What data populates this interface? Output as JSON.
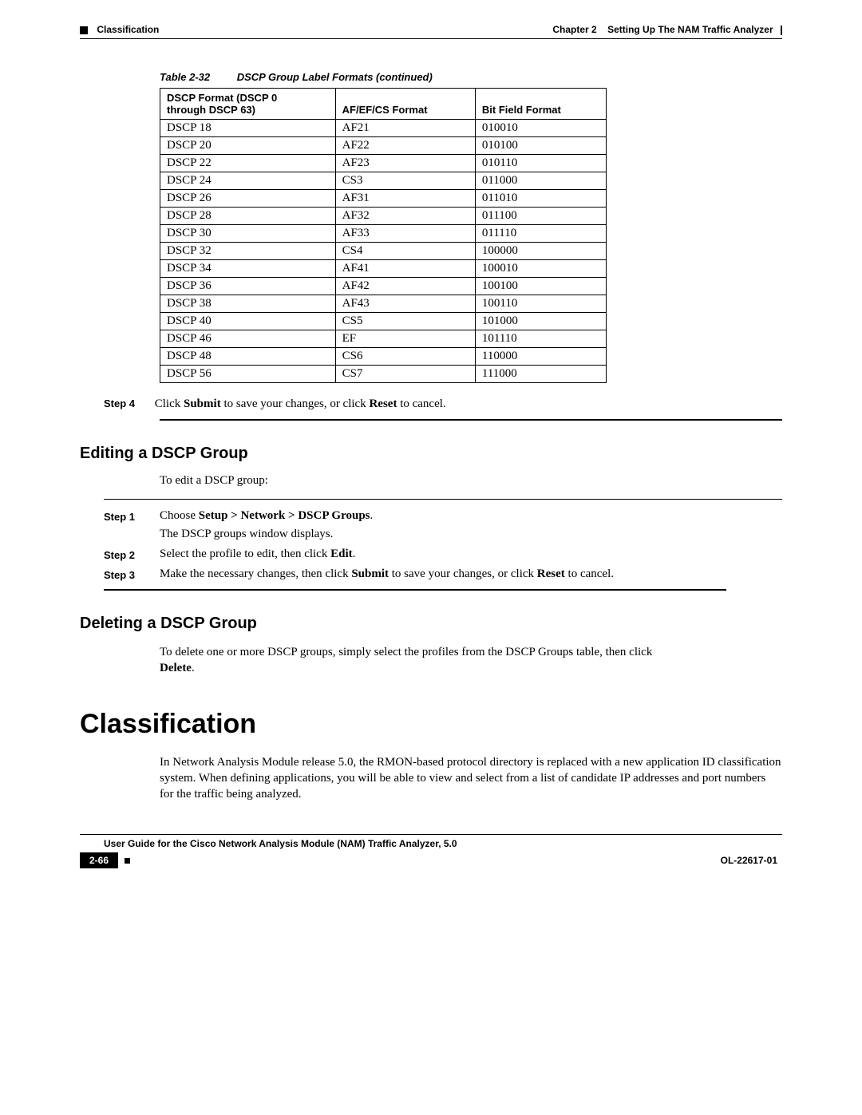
{
  "header": {
    "left": "Classification",
    "chapter_label": "Chapter 2",
    "chapter_title": "Setting Up The NAM Traffic Analyzer"
  },
  "table": {
    "caption_number": "Table 2-32",
    "caption_title": "DSCP Group Label Formats (continued)",
    "headers": {
      "col1_line1": "DSCP Format (DSCP 0",
      "col1_line2": "through DSCP 63)",
      "col2": "AF/EF/CS Format",
      "col3": "Bit Field Format"
    },
    "rows": [
      {
        "c1": "DSCP 18",
        "c2": "AF21",
        "c3": "010010"
      },
      {
        "c1": "DSCP 20",
        "c2": "AF22",
        "c3": "010100"
      },
      {
        "c1": "DSCP 22",
        "c2": "AF23",
        "c3": "010110"
      },
      {
        "c1": "DSCP 24",
        "c2": "CS3",
        "c3": "011000"
      },
      {
        "c1": "DSCP 26",
        "c2": "AF31",
        "c3": "011010"
      },
      {
        "c1": "DSCP 28",
        "c2": "AF32",
        "c3": "011100"
      },
      {
        "c1": "DSCP 30",
        "c2": "AF33",
        "c3": "011110"
      },
      {
        "c1": "DSCP 32",
        "c2": "CS4",
        "c3": "100000"
      },
      {
        "c1": "DSCP 34",
        "c2": "AF41",
        "c3": "100010"
      },
      {
        "c1": "DSCP 36",
        "c2": "AF42",
        "c3": "100100"
      },
      {
        "c1": "DSCP 38",
        "c2": "AF43",
        "c3": "100110"
      },
      {
        "c1": "DSCP 40",
        "c2": "CS5",
        "c3": "101000"
      },
      {
        "c1": "DSCP 46",
        "c2": "EF",
        "c3": "101110"
      },
      {
        "c1": "DSCP 48",
        "c2": "CS6",
        "c3": "110000"
      },
      {
        "c1": "DSCP 56",
        "c2": "CS7",
        "c3": "111000"
      }
    ]
  },
  "step4": {
    "label": "Step 4",
    "pre": "Click ",
    "b1": "Submit",
    "mid": " to save your changes, or click ",
    "b2": "Reset",
    "post": " to cancel."
  },
  "edit_section": {
    "title": "Editing a DSCP Group",
    "intro": "To edit a DSCP group:",
    "steps": [
      {
        "label": "Step 1",
        "line1_pre": "Choose ",
        "line1_b": "Setup > Network > DSCP Groups",
        "line1_post": ".",
        "line2": "The DSCP groups window displays."
      },
      {
        "label": "Step 2",
        "line1_pre": "Select the profile to edit, then click ",
        "line1_b": "Edit",
        "line1_post": "."
      },
      {
        "label": "Step 3",
        "line1_pre": "Make the necessary changes, then click ",
        "line1_b": "Submit",
        "line1_mid": " to save your changes, or click ",
        "line1_b2": "Reset",
        "line1_post": " to cancel."
      }
    ]
  },
  "delete_section": {
    "title": "Deleting a DSCP Group",
    "para_pre": "To delete one or more DSCP groups, simply select the profiles from the DSCP Groups table, then click ",
    "para_b": "Delete",
    "para_post": "."
  },
  "classification": {
    "title": "Classification",
    "para": "In Network Analysis Module release 5.0, the RMON-based protocol directory is replaced with a new application ID classification system. When defining applications, you will be able to view and select from a list of candidate IP addresses and port numbers for the traffic being analyzed."
  },
  "footer": {
    "doc_title": "User Guide for the Cisco Network Analysis Module (NAM) Traffic Analyzer, 5.0",
    "page_num": "2-66",
    "doc_id": "OL-22617-01"
  }
}
